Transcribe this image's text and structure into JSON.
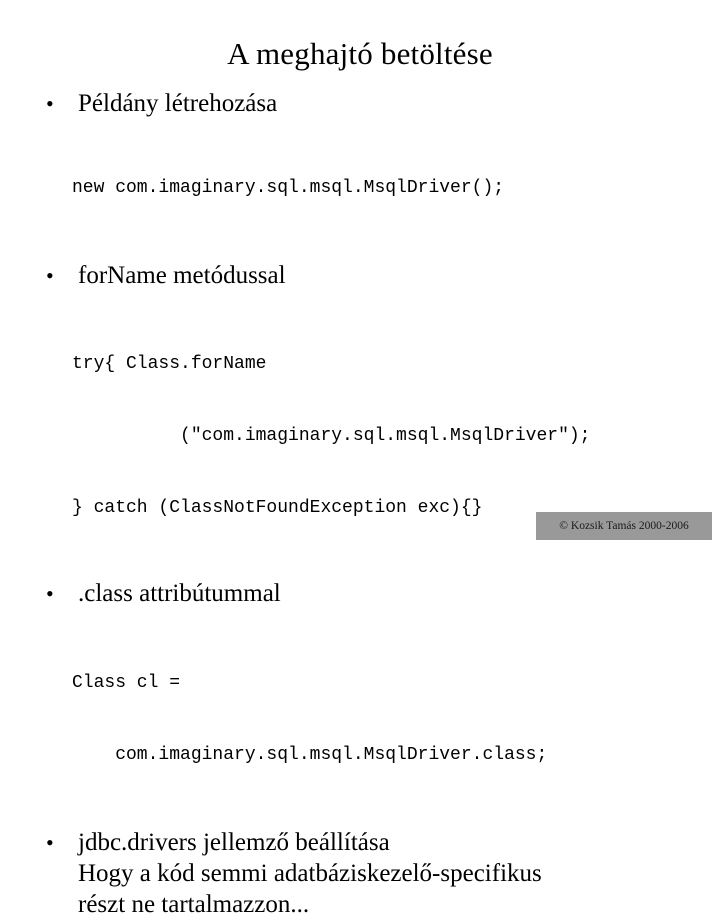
{
  "slide": {
    "title": "A meghajtó betöltése",
    "bullets": [
      {
        "marker": "•",
        "lines": [
          "Példány létrehozása"
        ],
        "code": [
          "new com.imaginary.sql.msql.MsqlDriver();"
        ]
      },
      {
        "marker": "•",
        "lines": [
          "forName metódussal"
        ],
        "code": [
          "try{ Class.forName",
          "          (\"com.imaginary.sql.msql.MsqlDriver\");",
          "} catch (ClassNotFoundException exc){}"
        ]
      },
      {
        "marker": "•",
        "lines": [
          ".class attribútummal"
        ],
        "code": [
          "Class cl =",
          "    com.imaginary.sql.msql.MsqlDriver.class;"
        ]
      },
      {
        "marker": "•",
        "lines": [
          "jdbc.drivers jellemző beállítása",
          "Hogy a kód semmi adatbáziskezelő-specifikus",
          "részt ne tartalmazzon..."
        ],
        "code": []
      }
    ],
    "footer": "© Kozsik Tamás 2000-2006"
  },
  "colors": {
    "background": "#ffffff",
    "text": "#000000",
    "footer_background": "#999999",
    "footer_text": "#1a1a1a"
  }
}
